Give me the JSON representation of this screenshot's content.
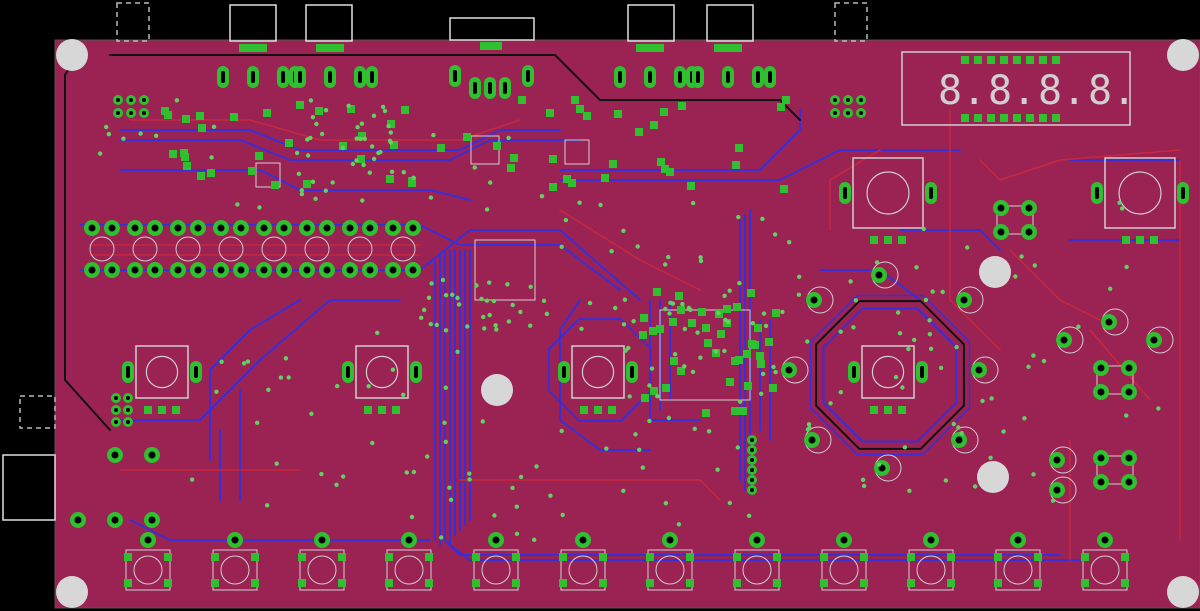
{
  "view": {
    "name": "pcb-layout-view",
    "background": "#000000"
  },
  "colors": {
    "board": "#9b2354",
    "top_copper": "#c8283c",
    "bottom_copper": "#3a2fd6",
    "pad": "#2ec02e",
    "via": "#5fd25f",
    "silkscreen": "#cfcfcf",
    "drill": "#000000",
    "mount_hole": "#d7d7d7",
    "outline": "#ffffff"
  },
  "display": {
    "digits": [
      "8.",
      "8.",
      "8.",
      "8."
    ]
  },
  "icons": {
    "mount_hole": "mounting-hole-icon",
    "pad": "pad-icon",
    "via": "via-icon",
    "button": "tactile-switch-icon",
    "encoder": "rotary-encoder-icon"
  }
}
